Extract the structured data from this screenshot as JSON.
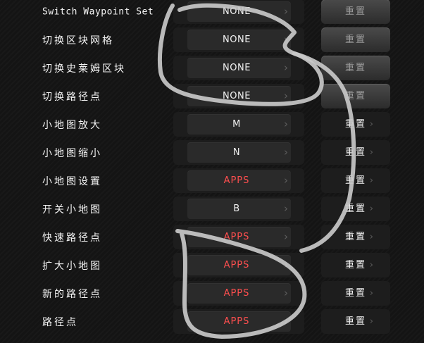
{
  "rows": [
    {
      "label": "Switch Waypoint Set",
      "key": "NONE",
      "reset": "重置"
    },
    {
      "label": "切换区块网格",
      "key": "NONE",
      "reset": "重置"
    },
    {
      "label": "切换史莱姆区块",
      "key": "NONE",
      "reset": "重置"
    },
    {
      "label": "切换路径点",
      "key": "NONE",
      "reset": "重置"
    },
    {
      "label": "小地图放大",
      "key": "M",
      "reset": "重置"
    },
    {
      "label": "小地图缩小",
      "key": "N",
      "reset": "重置"
    },
    {
      "label": "小地图设置",
      "key": "APPS",
      "reset": "重置"
    },
    {
      "label": "开关小地图",
      "key": "B",
      "reset": "重置"
    },
    {
      "label": "快速路径点",
      "key": "APPS",
      "reset": "重置"
    },
    {
      "label": "扩大小地图",
      "key": "APPS",
      "reset": "重置"
    },
    {
      "label": "新的路径点",
      "key": "APPS",
      "reset": "重置"
    },
    {
      "label": "路径点",
      "key": "APPS",
      "reset": "重置"
    }
  ],
  "colors": {
    "conflict_key": "#ff4f4f",
    "scribble": "#c8c8c8"
  },
  "icons": {
    "key_arrow": "chevron-right-icon"
  }
}
